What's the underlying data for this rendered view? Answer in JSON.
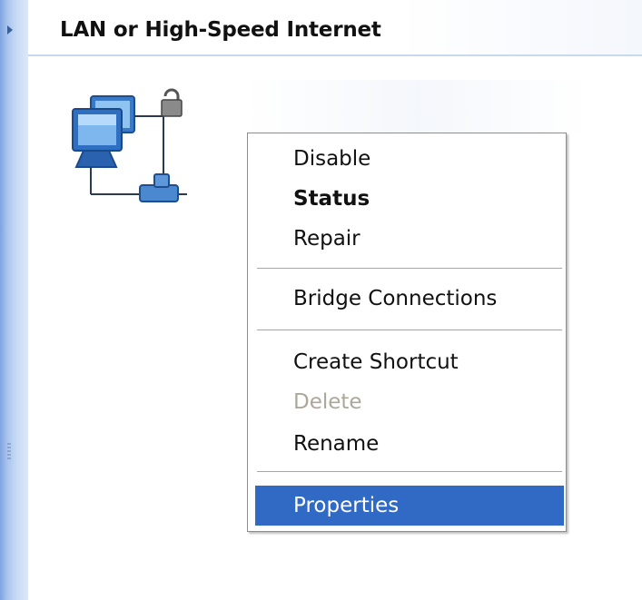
{
  "header": {
    "title": "LAN or High-Speed Internet"
  },
  "icon": {
    "name": "network-connection-icon"
  },
  "context_menu": {
    "items": [
      {
        "label": "Disable",
        "state": "normal"
      },
      {
        "label": "Status",
        "state": "default"
      },
      {
        "label": "Repair",
        "state": "normal"
      },
      {
        "label": "Bridge Connections",
        "state": "normal"
      },
      {
        "label": "Create Shortcut",
        "state": "normal"
      },
      {
        "label": "Delete",
        "state": "disabled"
      },
      {
        "label": "Rename",
        "state": "normal"
      },
      {
        "label": "Properties",
        "state": "selected"
      }
    ]
  },
  "colors": {
    "selection": "#316ac5",
    "disabled_text": "#aca899",
    "strip": "#a9c4ee"
  }
}
